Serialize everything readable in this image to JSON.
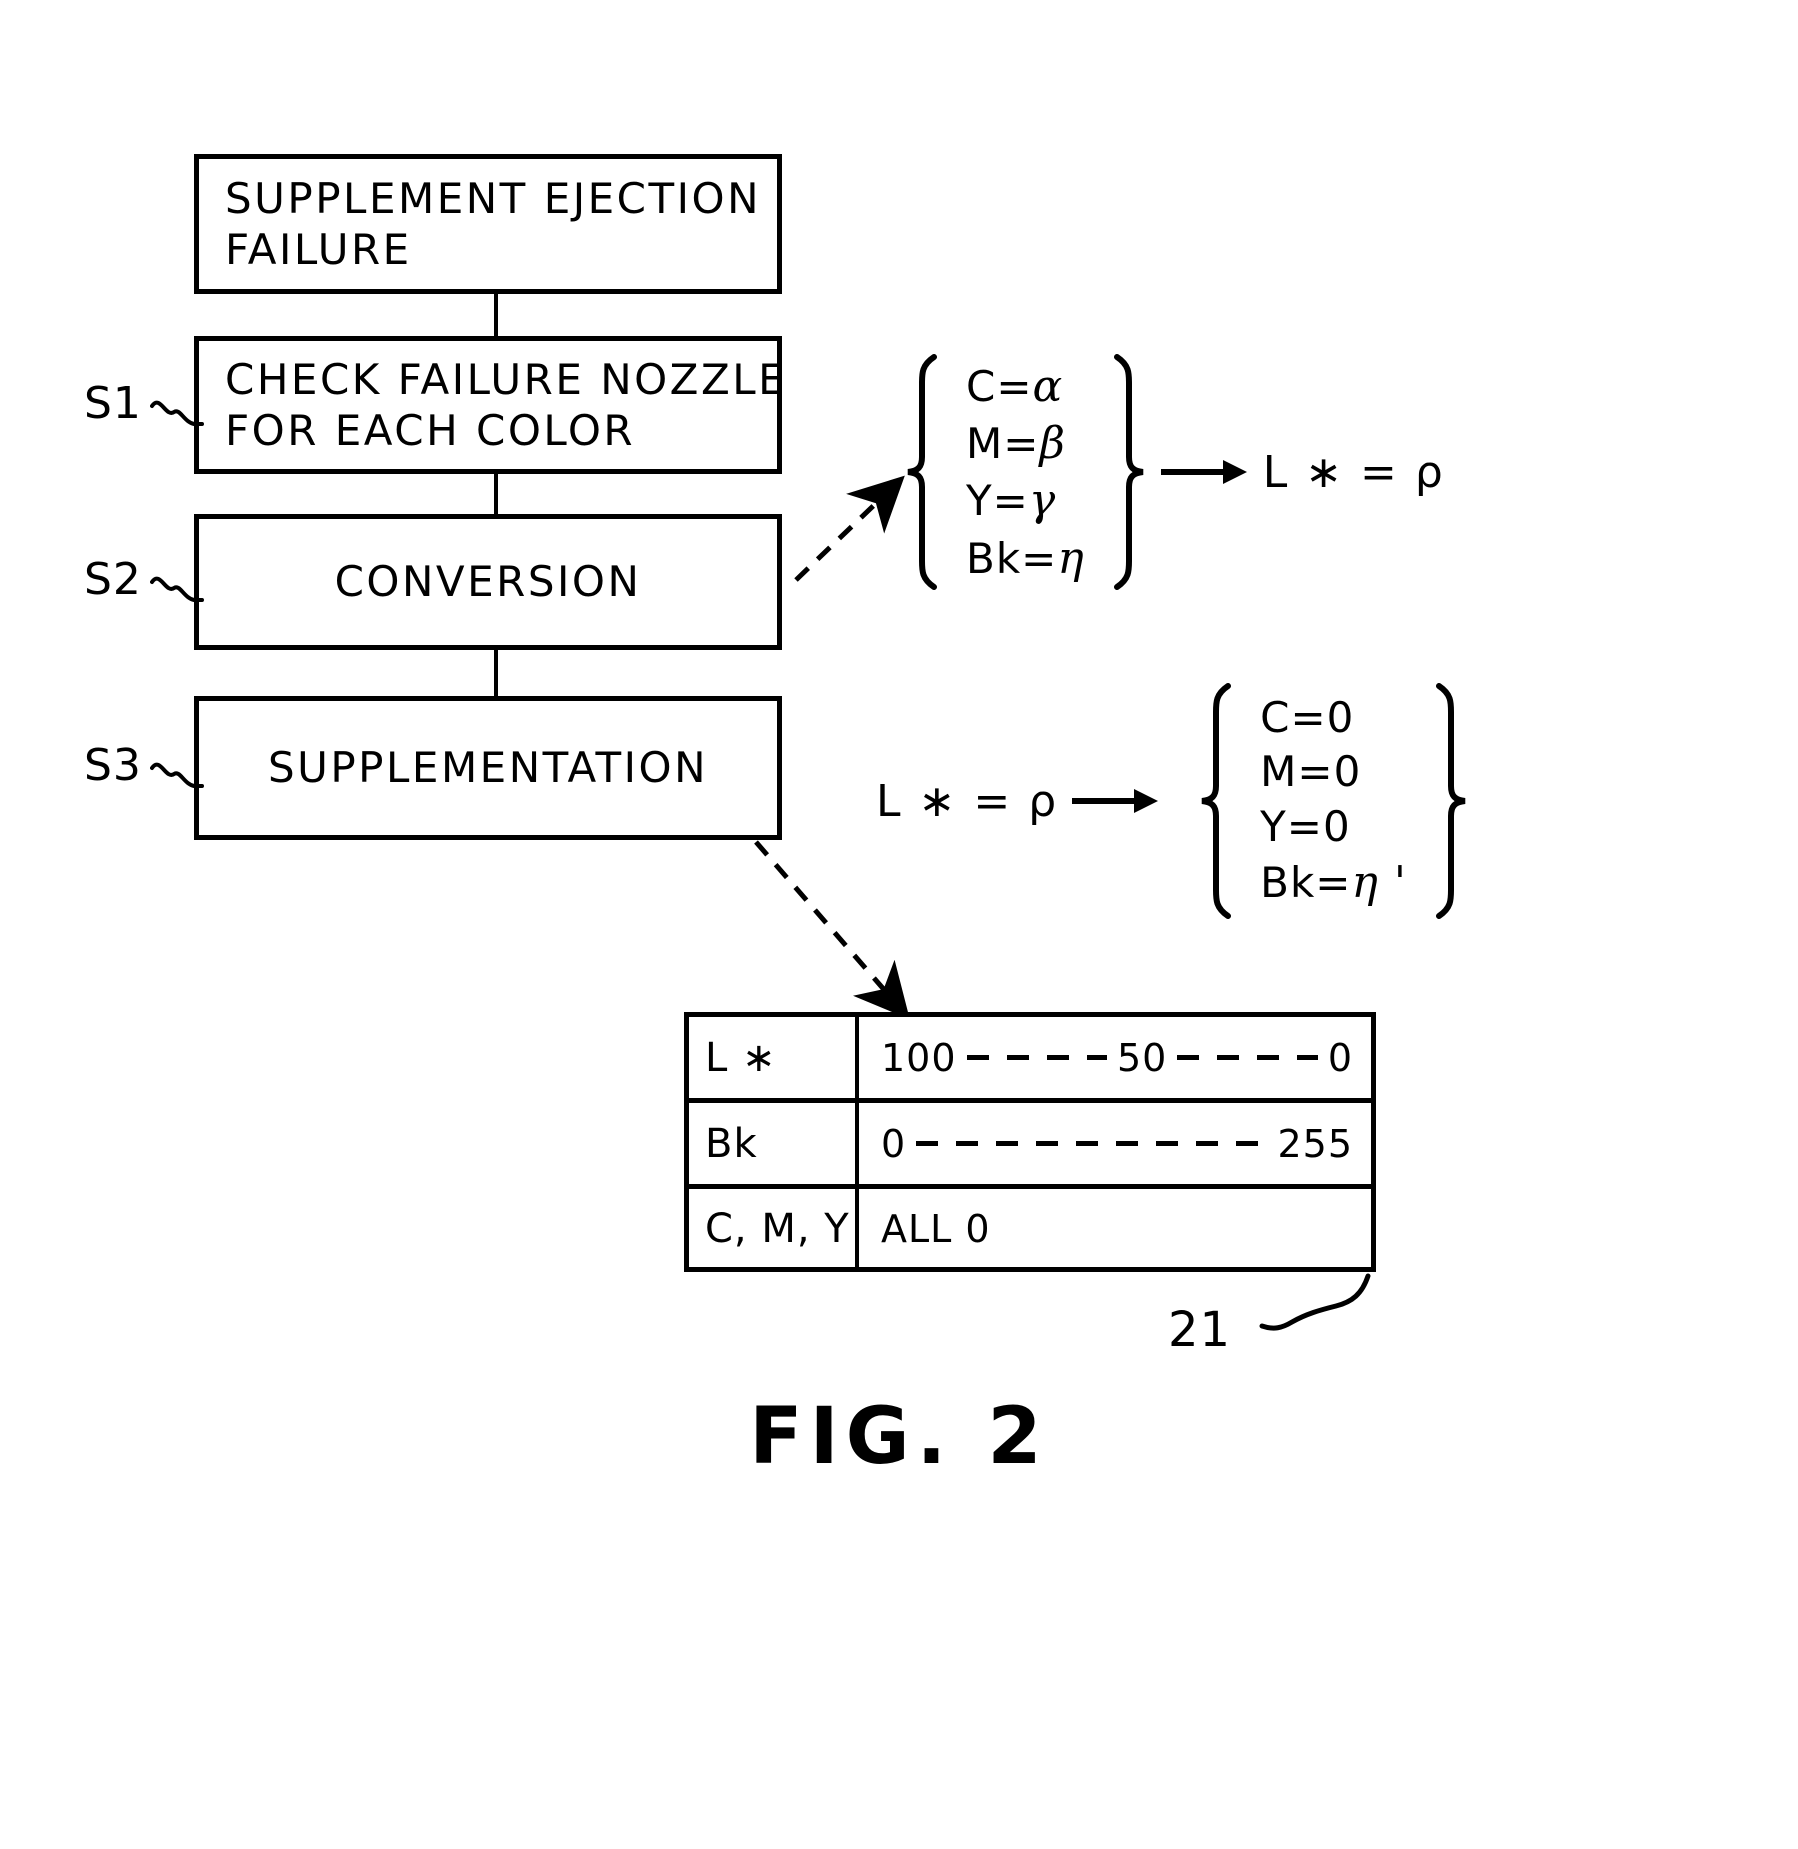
{
  "figure": {
    "caption": "FIG. 2",
    "reference_numeral": "21"
  },
  "flowchart": {
    "boxes": [
      {
        "id": "supplement-ejection-failure",
        "lines": [
          "SUPPLEMENT EJECTION",
          "FAILURE"
        ],
        "step": ""
      },
      {
        "id": "check-failure-nozzle",
        "lines": [
          "CHECK FAILURE NOZZLE",
          "FOR EACH COLOR"
        ],
        "step": "S1"
      },
      {
        "id": "conversion",
        "lines": [
          "CONVERSION"
        ],
        "step": "S2"
      },
      {
        "id": "supplementation",
        "lines": [
          "SUPPLEMENTATION"
        ],
        "step": "S3"
      }
    ],
    "step_labels": [
      "S1",
      "S2",
      "S3"
    ]
  },
  "equations": {
    "conversion": {
      "input_rows": [
        {
          "label": "C=",
          "value": "α"
        },
        {
          "label": "M=",
          "value": "β"
        },
        {
          "label": "Y=",
          "value": "γ"
        },
        {
          "label": "Bk=",
          "value": "η"
        }
      ],
      "arrow": "→",
      "result": "L ∗ = ρ"
    },
    "supplementation": {
      "input": "L ∗ = ρ",
      "arrow": "→",
      "output_rows": [
        {
          "label": "C=",
          "value": "0"
        },
        {
          "label": "M=",
          "value": "0"
        },
        {
          "label": "Y=",
          "value": "0"
        },
        {
          "label": "Bk=",
          "value": "η '"
        }
      ]
    }
  },
  "table": {
    "rows": [
      {
        "key": "L ∗",
        "type": "ramp",
        "start": "100",
        "middle": "50",
        "end": "0",
        "raw": "100------- 50--------- 0"
      },
      {
        "key": "Bk",
        "type": "ramp",
        "start": "0",
        "middle": "",
        "end": "255",
        "raw": "0---------------- 255"
      },
      {
        "key": "C, M, Y",
        "type": "text",
        "value": "ALL 0"
      }
    ]
  }
}
